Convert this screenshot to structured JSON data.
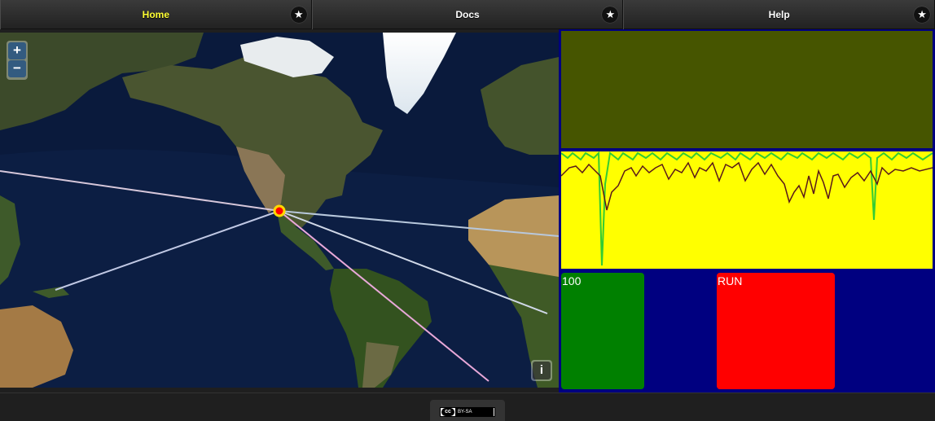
{
  "nav": {
    "tabs": [
      {
        "label": "Home",
        "active": true,
        "icon": "star-icon"
      },
      {
        "label": "Docs",
        "active": false,
        "icon": "star-icon"
      },
      {
        "label": "Help",
        "active": false,
        "icon": "star-icon"
      }
    ]
  },
  "map": {
    "zoom_in": "+",
    "zoom_out": "−",
    "info": "i"
  },
  "panel": {
    "colors": {
      "top": "#465500",
      "mid": "#ffff00",
      "bottom": "#000080",
      "green_line": "#33cc33",
      "dark_line": "#5a1a1a"
    },
    "green_box_label": "100",
    "red_box_label": "RUN"
  },
  "footer": {
    "license_logo": "cc",
    "license_text": "BY-SA"
  }
}
